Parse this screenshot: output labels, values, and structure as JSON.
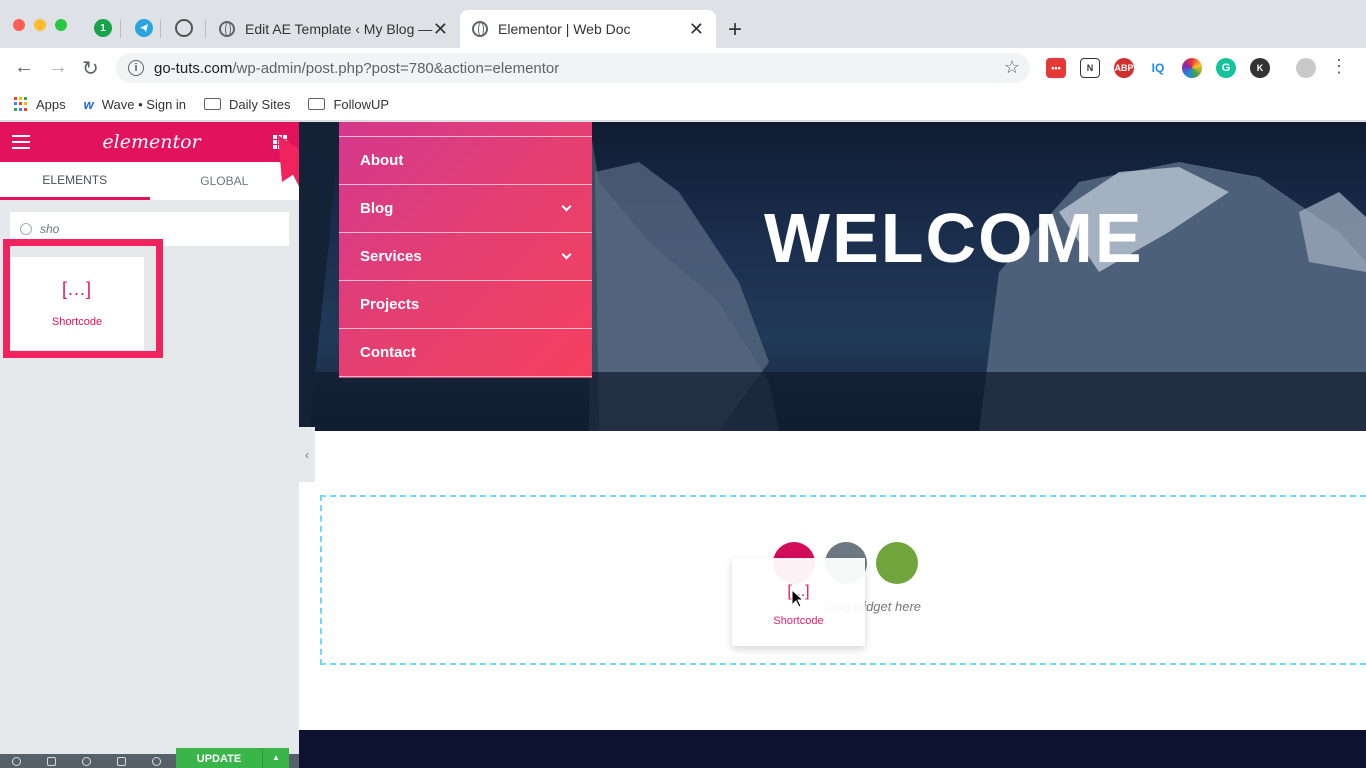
{
  "browser": {
    "tabs": [
      {
        "title": "Edit AE Template ‹ My Blog — ",
        "active": false
      },
      {
        "title": "Elementor | Web Doc",
        "active": true
      }
    ],
    "pinned": [
      "1"
    ],
    "url_host": "go-tuts.com",
    "url_path": "/wp-admin/post.php?post=780&action=elementor",
    "bookmarks": [
      "Apps",
      "Wave • Sign in",
      "Daily Sites",
      "FollowUP"
    ],
    "extensions": [
      "ABP",
      "IQ",
      "K"
    ]
  },
  "panel": {
    "logo": "elementor",
    "tabs": [
      "ELEMENTS",
      "GLOBAL"
    ],
    "search_value": "sho",
    "result_label": "Shortcode",
    "result_icon": "[...]",
    "update_label": "UPDATE",
    "accent": "#e2135c"
  },
  "preview": {
    "menu": [
      {
        "label": "About",
        "has_children": false
      },
      {
        "label": "Blog",
        "has_children": true
      },
      {
        "label": "Services",
        "has_children": true
      },
      {
        "label": "Projects",
        "has_children": false
      },
      {
        "label": "Contact",
        "has_children": false
      }
    ],
    "hero_title": "WELCOME",
    "drop_hint": "here",
    "drag_label": "Shortcode",
    "drag_icon": "[...]"
  }
}
